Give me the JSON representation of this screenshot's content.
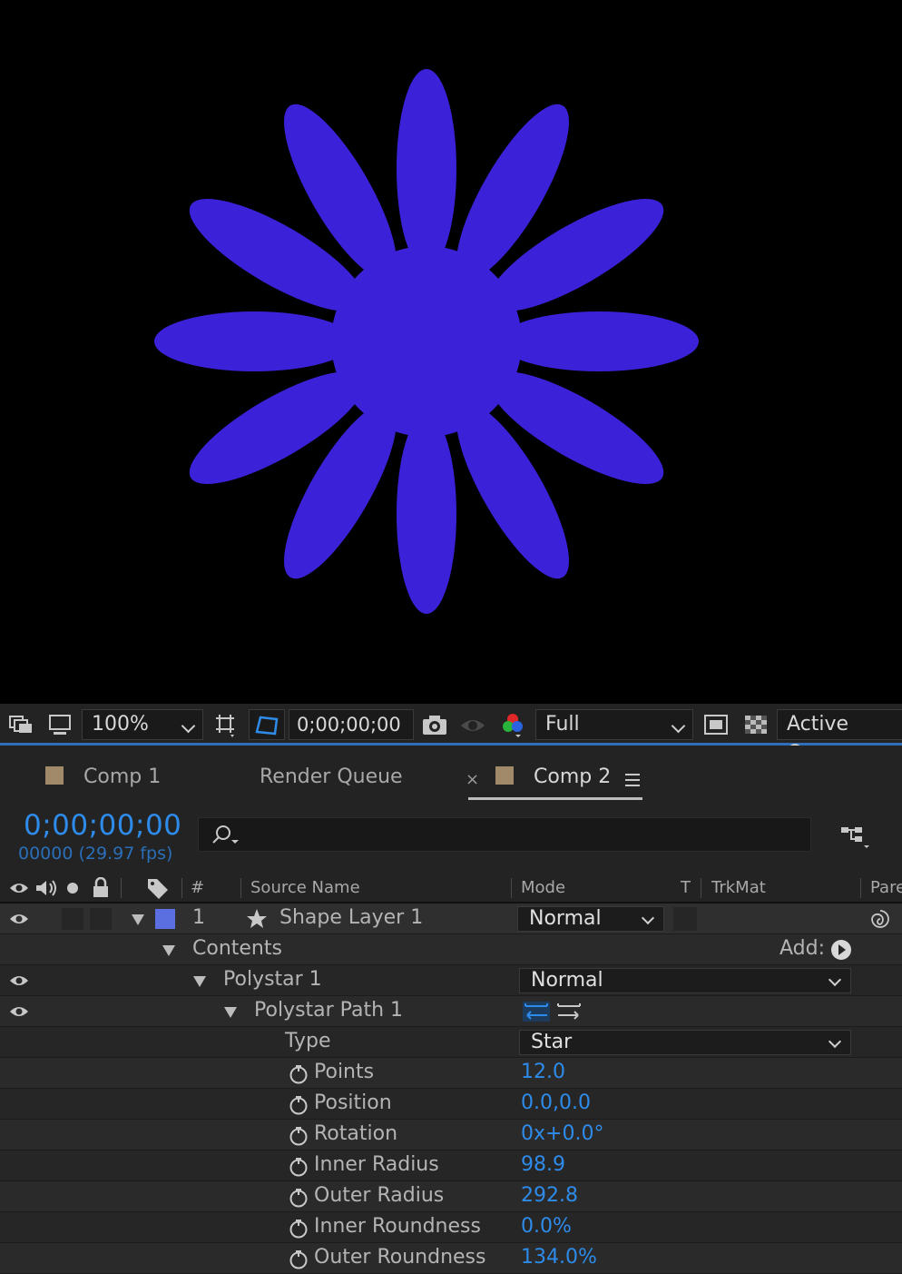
{
  "viewer": {
    "shape_fill": "#3b22d8",
    "background": "#000000"
  },
  "viewer_toolbar": {
    "zoom": "100%",
    "timecode": "0;00;00;00",
    "resolution": "Full",
    "camera": "Active Camera"
  },
  "tabs": [
    {
      "label": "Comp 1"
    },
    {
      "label": "Render Queue"
    },
    {
      "label": "Comp 2",
      "active": true
    }
  ],
  "tab_close_glyph": "×",
  "timeline": {
    "timecode": "0;00;00;00",
    "frame_info": "00000 (29.97 fps)",
    "accent": "#2e8bea"
  },
  "columns": {
    "hash": "#",
    "source_name": "Source Name",
    "mode": "Mode",
    "t": "T",
    "trkmat": "TrkMat",
    "parent": "Parent"
  },
  "layer": {
    "number": "1",
    "name": "Shape Layer 1",
    "mode": "Normal",
    "label_color": "#5b6fe0"
  },
  "contents": {
    "label": "Contents",
    "add_label": "Add:"
  },
  "polystar": {
    "label": "Polystar 1",
    "mode": "Normal"
  },
  "polystar_path": {
    "label": "Polystar Path 1"
  },
  "type_row": {
    "label": "Type",
    "value": "Star"
  },
  "properties": [
    {
      "label": "Points",
      "value": "12.0"
    },
    {
      "label": "Position",
      "value": "0.0,0.0"
    },
    {
      "label": "Rotation",
      "value": "0x+0.0°"
    },
    {
      "label": "Inner Radius",
      "value": "98.9"
    },
    {
      "label": "Outer Radius",
      "value": "292.8"
    },
    {
      "label": "Inner Roundness",
      "value": "0.0%"
    },
    {
      "label": "Outer Roundness",
      "value": "134.0%"
    }
  ]
}
